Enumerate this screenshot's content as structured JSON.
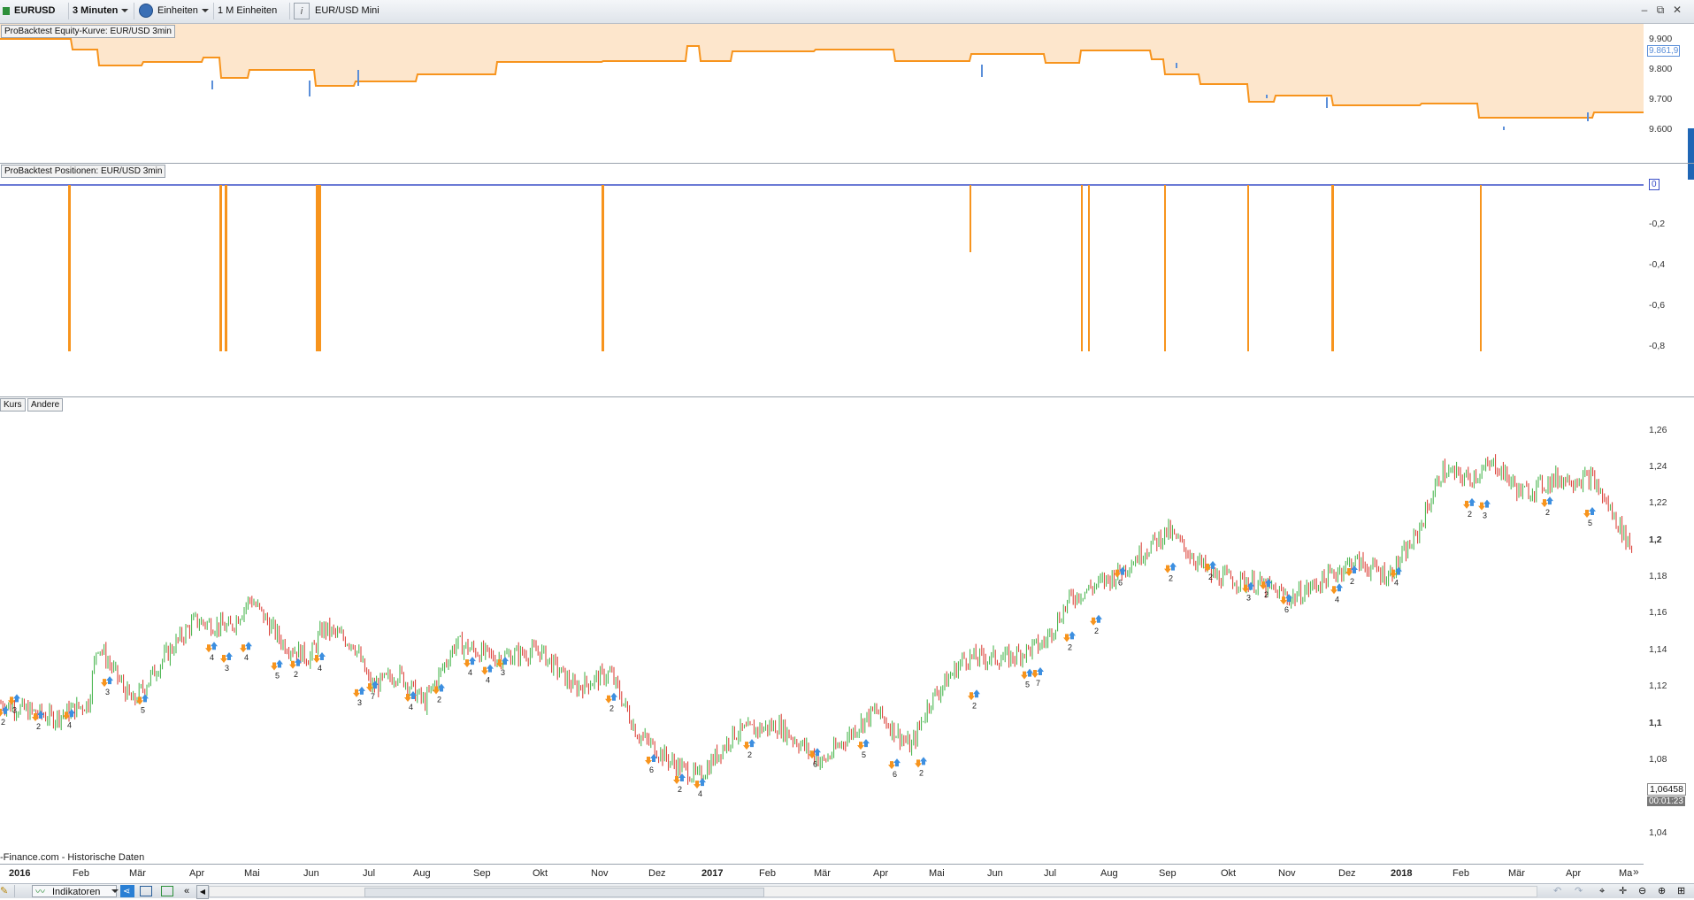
{
  "toolbar": {
    "symbol": "EURUSD",
    "interval": "3 Minuten",
    "units": "Einheiten",
    "units_count": "1 M Einheiten",
    "info_icon": "i",
    "instrument_name": "EUR/USD Mini"
  },
  "window_buttons": {
    "minimize": "–",
    "restore": "⧉",
    "close": "✕"
  },
  "equity_panel": {
    "title": "ProBacktest Equity-Kurve: EUR/USD 3min",
    "axis_labels": [
      "9.900",
      "9.800",
      "9.700",
      "9.600"
    ],
    "current_value": "9.861,9",
    "colors": {
      "area": "#fde6cc",
      "line": "#f7941d",
      "down_line": "#5b8fd9"
    }
  },
  "positions_panel": {
    "title": "ProBacktest Positionen: EUR/USD 3min",
    "axis_labels": [
      "-0,2",
      "-0,4",
      "-0,6",
      "-0,8"
    ],
    "zero_label": "0",
    "colors": {
      "bar": "#f7941d",
      "zero_line": "#3a4fc7"
    }
  },
  "price_panel": {
    "tabs": [
      "Kurs",
      "Andere"
    ],
    "axis_labels": [
      "1,26",
      "1,24",
      "1,22",
      "1,2",
      "1,18",
      "1,16",
      "1,14",
      "1,12",
      "1,1",
      "1,08",
      "1,04"
    ],
    "current_price": "1,06458",
    "countdown": "00:01:23",
    "source": "-Finance.com - Historische Daten",
    "colors": {
      "up": "#3cb043",
      "down": "#d9342b",
      "buy_arrow": "#3d8fe0",
      "sell_arrow": "#f7941d"
    }
  },
  "time_axis": {
    "labels": [
      "2016",
      "Feb",
      "Mär",
      "Apr",
      "Mai",
      "Jun",
      "Jul",
      "Aug",
      "Sep",
      "Okt",
      "Nov",
      "Dez",
      "2017",
      "Feb",
      "Mär",
      "Apr",
      "Mai",
      "Jun",
      "Jul",
      "Aug",
      "Sep",
      "Okt",
      "Nov",
      "Dez",
      "2018",
      "Feb",
      "Mär",
      "Apr",
      "Ma"
    ],
    "more": "»"
  },
  "bottom_bar": {
    "indicators_label": "Indikatoren",
    "collapse": "«"
  },
  "trade_labels": [
    "2",
    "3",
    "2",
    "4",
    "3",
    "5",
    "4",
    "3",
    "4",
    "5",
    "2",
    "4",
    "3",
    "7",
    "4",
    "2",
    "4",
    "4",
    "3",
    "2",
    "6",
    "2",
    "4",
    "2",
    "6",
    "5",
    "6",
    "2",
    "2",
    "5",
    "7",
    "2",
    "2",
    "6",
    "2",
    "2",
    "3",
    "2",
    "6",
    "4",
    "2",
    "4",
    "2",
    "3",
    "2",
    "5"
  ]
}
